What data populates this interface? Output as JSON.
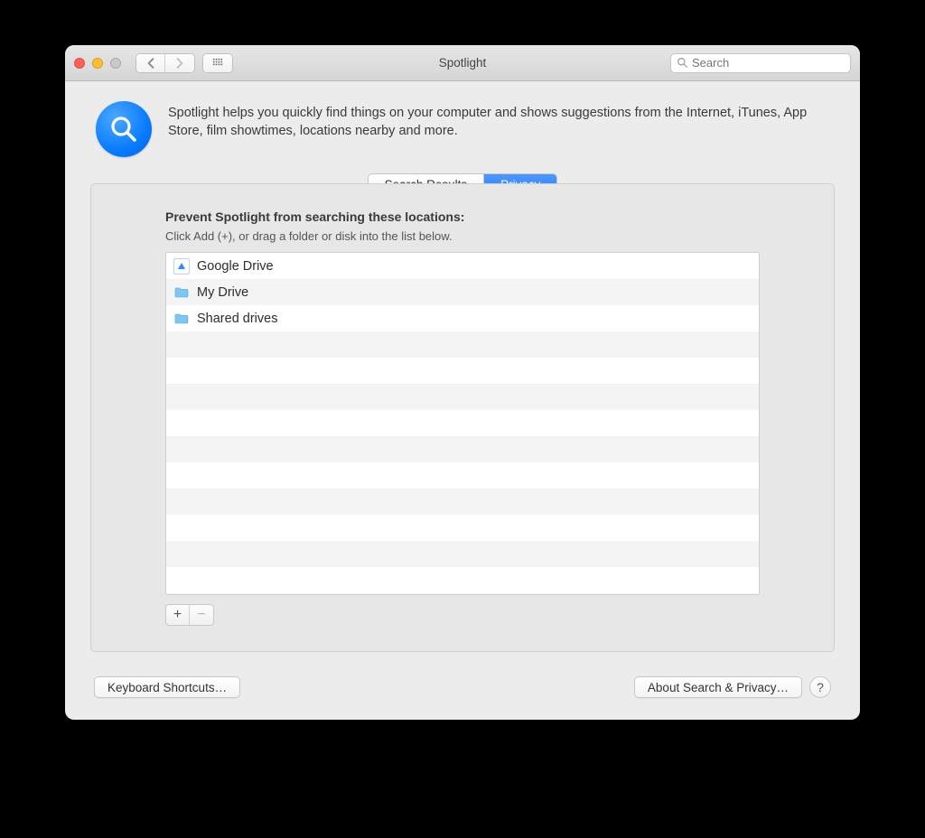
{
  "window": {
    "title": "Spotlight"
  },
  "search": {
    "placeholder": "Search"
  },
  "description": "Spotlight helps you quickly find things on your computer and shows suggestions from the Internet, iTunes, App Store, film showtimes, locations nearby and more.",
  "tabs": {
    "items": [
      {
        "label": "Search Results",
        "active": false
      },
      {
        "label": "Privacy",
        "active": true
      }
    ]
  },
  "panel": {
    "heading": "Prevent Spotlight from searching these locations:",
    "hint": "Click Add (+), or drag a folder or disk into the list below.",
    "rows": [
      {
        "icon": "google-drive-icon",
        "label": "Google Drive"
      },
      {
        "icon": "folder-icon",
        "label": "My Drive"
      },
      {
        "icon": "folder-icon",
        "label": "Shared drives"
      }
    ],
    "add_label": "+",
    "remove_label": "−"
  },
  "footer": {
    "keyboard_shortcuts": "Keyboard Shortcuts…",
    "about": "About Search & Privacy…",
    "help": "?"
  }
}
